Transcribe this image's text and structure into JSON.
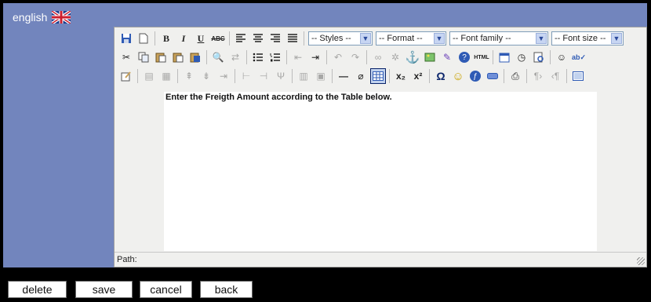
{
  "language": {
    "label": "english",
    "flag_icon": "uk-flag-icon"
  },
  "toolbar": {
    "bold_label": "B",
    "italic_label": "I",
    "underline_label": "U",
    "strike_label": "ABC",
    "styles_select": "-- Styles --",
    "format_select": "-- Format --",
    "font_family_select": "-- Font family --",
    "font_size_select": "-- Font size --"
  },
  "editor": {
    "content_text": "Enter the Freigth Amount according to the Table below.",
    "path_label": "Path:"
  },
  "buttons": {
    "delete": "delete",
    "save": "save",
    "cancel": "cancel",
    "back": "back"
  },
  "colors": {
    "panel": "#7285bd",
    "background": "#000000",
    "editor_chrome": "#f0f0ee"
  }
}
